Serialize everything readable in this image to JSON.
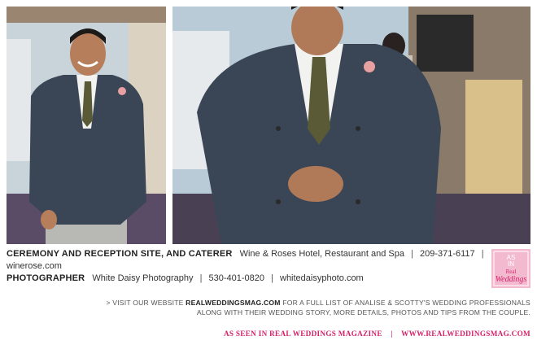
{
  "credits": {
    "ceremony": {
      "label": "CEREMONY AND RECEPTION SITE, AND CATERER",
      "name": "Wine & Roses Hotel, Restaurant and Spa",
      "phone": "209-371-6117",
      "website": "winerose.com"
    },
    "photographer": {
      "label": "PHOTOGRAPHER",
      "name": "White Daisy Photography",
      "phone": "530-401-0820",
      "website": "whitedaisyphoto.com"
    }
  },
  "badge": {
    "line1": "AS",
    "line2": "IN",
    "line3": "Real",
    "line4": "Weddings"
  },
  "visit": {
    "prefix": "> VISIT OUR WEBSITE",
    "site": "REALWEDDINGSMAG.COM",
    "rest1": "FOR A FULL LIST OF ANALISE & SCOTTY'S WEDDING PROFESSIONALS",
    "line2": "ALONG WITH THEIR WEDDING STORY, MORE DETAILS, PHOTOS AND TIPS FROM THE COUPLE."
  },
  "footer": {
    "left": "AS SEEN IN REAL WEDDINGS MAGAZINE",
    "separator": "|",
    "right": "WWW.REALWEDDINGSMAG.COM"
  },
  "colors": {
    "accent": "#d6226a",
    "jacket": "#3a4656",
    "wall": "#b9cbd6"
  }
}
